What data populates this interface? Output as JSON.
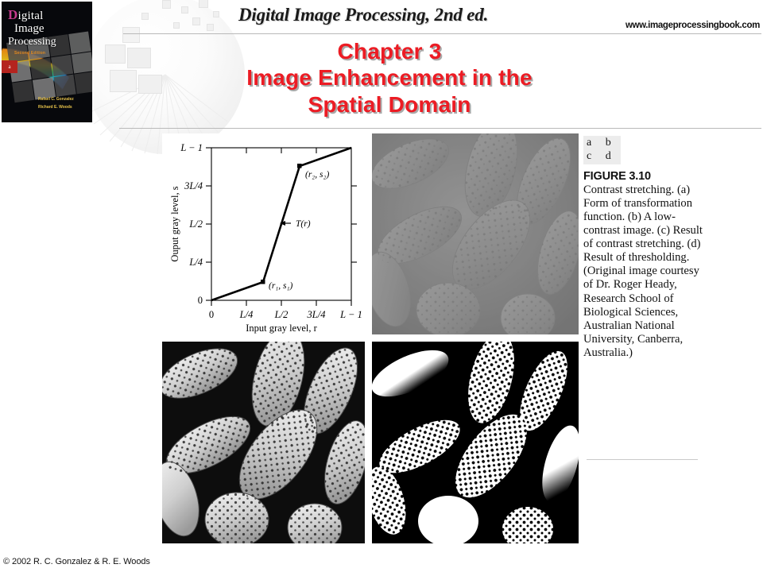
{
  "header": {
    "book_title": "Digital Image Processing, 2nd ed.",
    "website": "www.imageprocessingbook.com"
  },
  "book_cover": {
    "word1": "Digital",
    "word1_cap": "D",
    "word1_rest": "igital",
    "word2": "Image",
    "word3": "Processing",
    "edition": "Second Edition",
    "author1": "Rafael C. Gonzalez",
    "author2": "Richard E. Woods",
    "tab_label": "a"
  },
  "chapter": {
    "line1": "Chapter 3",
    "line2": "Image Enhancement in the",
    "line3": "Spatial Domain",
    "color": "#ec1c24"
  },
  "figure": {
    "key_row1": "a b",
    "key_row2": "c d",
    "label": "FIGURE 3.10",
    "caption": "Contrast stretching. (a) Form of transformation function. (b) A low-contrast image. (c) Result of contrast stretching. (d) Result of thresholding. (Original image courtesy of Dr. Roger Heady, Research School of Biological Sciences, Australian National University, Canberra, Australia.)",
    "panels": [
      {
        "id": "a",
        "name": "transformation-function-plot"
      },
      {
        "id": "b",
        "name": "low-contrast-pollen-image"
      },
      {
        "id": "c",
        "name": "contrast-stretched-pollen-image"
      },
      {
        "id": "d",
        "name": "thresholded-pollen-image"
      }
    ]
  },
  "footer": {
    "copyright": "© 2002 R. C. Gonzalez & R. E. Woods"
  },
  "chart_data": {
    "type": "line",
    "title": "",
    "xlabel": "Input gray level, r",
    "ylabel": "Ouput gray level, s",
    "xticks": [
      "0",
      "L/4",
      "L/2",
      "3L/4",
      "L − 1"
    ],
    "yticks": [
      "0",
      "L/4",
      "L/2",
      "3L/4",
      "L − 1"
    ],
    "xtick_values": [
      0,
      0.25,
      0.5,
      0.75,
      1.0
    ],
    "ytick_values": [
      0,
      0.25,
      0.5,
      0.75,
      1.0
    ],
    "xlim": [
      0,
      1
    ],
    "ylim": [
      0,
      1
    ],
    "grid": false,
    "legend": "none",
    "series": [
      {
        "name": "T(r)",
        "x": [
          0.0,
          0.37,
          0.63,
          1.0
        ],
        "y": [
          0.0,
          0.12,
          0.88,
          1.0
        ]
      }
    ],
    "annotations": [
      {
        "text": "(r₁, s₁)",
        "x": 0.37,
        "y": 0.12,
        "marker": true
      },
      {
        "text": "(r₂, s₂)",
        "x": 0.63,
        "y": 0.88,
        "marker": true
      },
      {
        "text": "T(r)",
        "x": 0.5,
        "y": 0.5,
        "arrow": true
      }
    ]
  }
}
